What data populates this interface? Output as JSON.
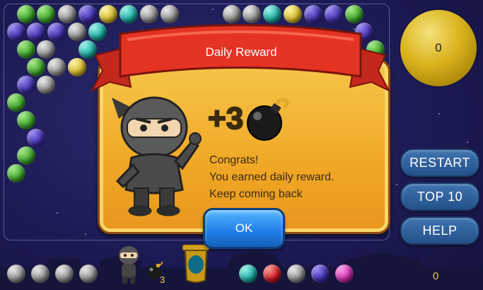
{
  "dialog": {
    "title": "Daily Reward",
    "reward_amount": "+3",
    "reward_item": "bomb-icon",
    "message_lines": [
      "Congrats!",
      "You earned daily reward.",
      "Keep coming back"
    ],
    "ok_label": "OK"
  },
  "sidebar": {
    "score": "0",
    "restart_label": "RESTART",
    "top10_label": "TOP 10",
    "help_label": "HELP"
  },
  "bottom_bar": {
    "bomb_count": "3",
    "score": "0"
  },
  "colors": {
    "dialog_bg": "#f0a826",
    "banner_red": "#e53323",
    "button_blue": "#24518a",
    "ok_blue": "#1e7ee6",
    "score_orb": "#d9b21c"
  }
}
